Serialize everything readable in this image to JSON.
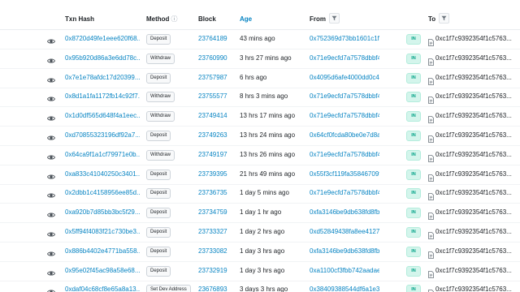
{
  "table": {
    "headers": {
      "txn_hash": "Txn Hash",
      "method": "Method",
      "block": "Block",
      "age": "Age",
      "from": "From",
      "to": "To"
    },
    "icons": {
      "row_view": "eye-icon",
      "method_info": "info-icon",
      "filter": "filter-icon",
      "contract": "document-icon"
    },
    "direction_label": "IN",
    "colors": {
      "link": "#0784c3",
      "in_badge": "#00a186",
      "in_badge_bg": "#d4f5ec"
    },
    "rows": [
      {
        "hash": "0x8720d49fe1eee620f68...",
        "method": "Deposit",
        "block": "23764189",
        "age": "43 mins ago",
        "from": "0x752369d73bb1601c1f...",
        "to": "0xc1f7c9392354f1c5763..."
      },
      {
        "hash": "0x95b920d86a3e6dd78c...",
        "method": "Withdraw",
        "block": "23760990",
        "age": "3 hrs 27 mins ago",
        "from": "0x71e9ecfd7a7578dbbf4...",
        "to": "0xc1f7c9392354f1c5763..."
      },
      {
        "hash": "0x7e1e78afdc17d20399...",
        "method": "Deposit",
        "block": "23757987",
        "age": "6 hrs ago",
        "from": "0x4095d6afe4000dd0c4...",
        "to": "0xc1f7c9392354f1c5763..."
      },
      {
        "hash": "0x8d1a1fa1172fb14c92f7...",
        "method": "Withdraw",
        "block": "23755577",
        "age": "8 hrs 3 mins ago",
        "from": "0x71e9ecfd7a7578dbbf4...",
        "to": "0xc1f7c9392354f1c5763..."
      },
      {
        "hash": "0x1d0df565d648f4a1eec...",
        "method": "Withdraw",
        "block": "23749414",
        "age": "13 hrs 17 mins ago",
        "from": "0x71e9ecfd7a7578dbbf4...",
        "to": "0xc1f7c9392354f1c5763..."
      },
      {
        "hash": "0xd70855323196df92a7...",
        "method": "Deposit",
        "block": "23749263",
        "age": "13 hrs 24 mins ago",
        "from": "0x64cf0fcda80be0e7d8a...",
        "to": "0xc1f7c9392354f1c5763..."
      },
      {
        "hash": "0x64ca9f1a1cf79971e0b...",
        "method": "Withdraw",
        "block": "23749197",
        "age": "13 hrs 26 mins ago",
        "from": "0x71e9ecfd7a7578dbbf4...",
        "to": "0xc1f7c9392354f1c5763..."
      },
      {
        "hash": "0xa833c41040250c3401...",
        "method": "Deposit",
        "block": "23739395",
        "age": "21 hrs 49 mins ago",
        "from": "0x55f3cf119fa35846709f...",
        "to": "0xc1f7c9392354f1c5763..."
      },
      {
        "hash": "0x2dbb1c4158956ee85d...",
        "method": "Deposit",
        "block": "23736735",
        "age": "1 day 5 mins ago",
        "from": "0x71e9ecfd7a7578dbbf4...",
        "to": "0xc1f7c9392354f1c5763..."
      },
      {
        "hash": "0xa920b7d85bb3bc5f29...",
        "method": "Deposit",
        "block": "23734759",
        "age": "1 day 1 hr ago",
        "from": "0xfa3146be9db638fd8fb...",
        "to": "0xc1f7c9392354f1c5763..."
      },
      {
        "hash": "0x5ff94f4083f21c730be3...",
        "method": "Deposit",
        "block": "23733327",
        "age": "1 day 2 hrs ago",
        "from": "0xd52849438fa8ee4127...",
        "to": "0xc1f7c9392354f1c5763..."
      },
      {
        "hash": "0x886b4402e4771ba558...",
        "method": "Deposit",
        "block": "23733082",
        "age": "1 day 3 hrs ago",
        "from": "0xfa3146be9db638fd8fb...",
        "to": "0xc1f7c9392354f1c5763..."
      },
      {
        "hash": "0x95e02f45ac98a58e68...",
        "method": "Deposit",
        "block": "23732919",
        "age": "1 day 3 hrs ago",
        "from": "0xa1100cf3fbb742aadae...",
        "to": "0xc1f7c9392354f1c5763..."
      },
      {
        "hash": "0xdaf04c68cf8e65a8a13...",
        "method": "Set Dev Address",
        "block": "23676893",
        "age": "3 days 3 hrs ago",
        "from": "0x38409388544df6a1e3...",
        "to": "0xc1f7c9392354f1c5763..."
      }
    ]
  }
}
